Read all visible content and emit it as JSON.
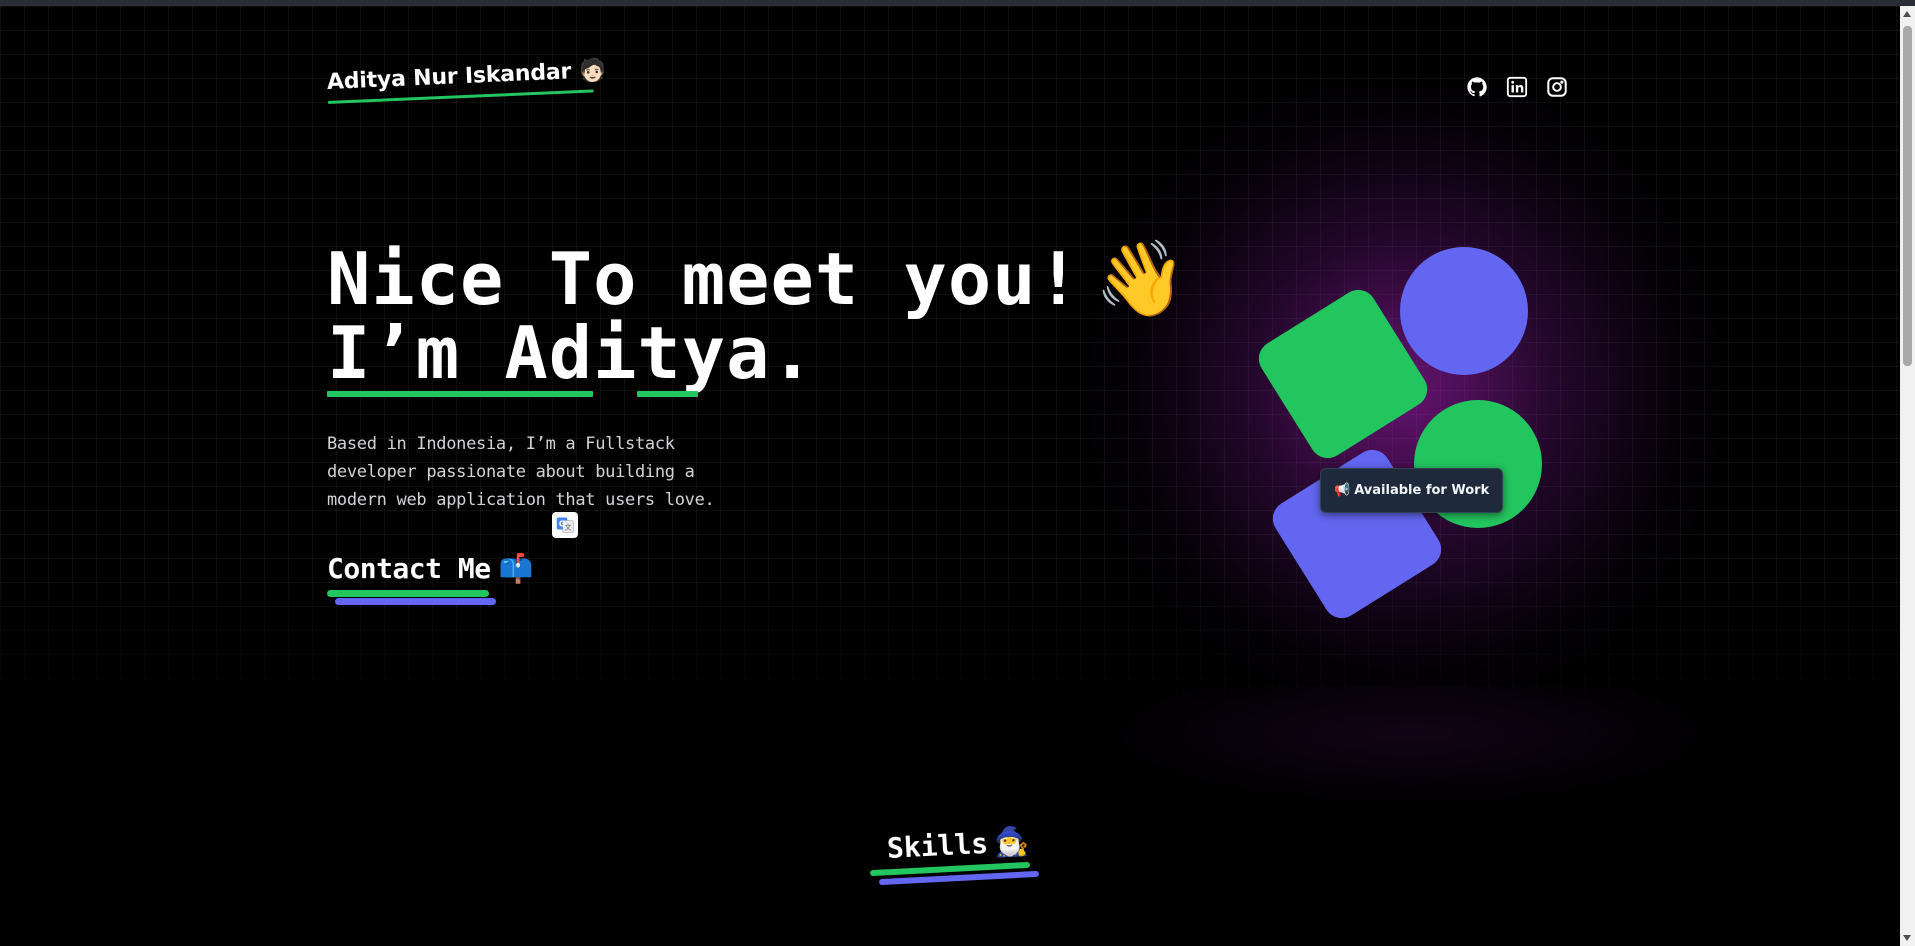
{
  "header": {
    "brand_name": "Aditya Nur Iskandar",
    "brand_emoji": "🧑🏻",
    "socials": [
      {
        "name": "github",
        "icon": "github-icon"
      },
      {
        "name": "linkedin",
        "icon": "linkedin-icon"
      },
      {
        "name": "instagram",
        "icon": "instagram-icon"
      }
    ]
  },
  "hero": {
    "title_line1": "Nice To meet you!",
    "wave_emoji": "👋",
    "title_line2": "I’m Aditya.",
    "bio": "Based in Indonesia, I’m a Fullstack developer passionate about building a modern web application that users love.",
    "contact_label": "Contact Me",
    "contact_emoji": "📫"
  },
  "badge": {
    "emoji": "📢",
    "label": "Available for Work"
  },
  "skills": {
    "title": "Skills",
    "emoji": "🧙‍♂️"
  },
  "colors": {
    "accent_green": "#22c55e",
    "accent_indigo": "#6366f1",
    "glow_purple": "#b923cd",
    "background": "#000000"
  }
}
